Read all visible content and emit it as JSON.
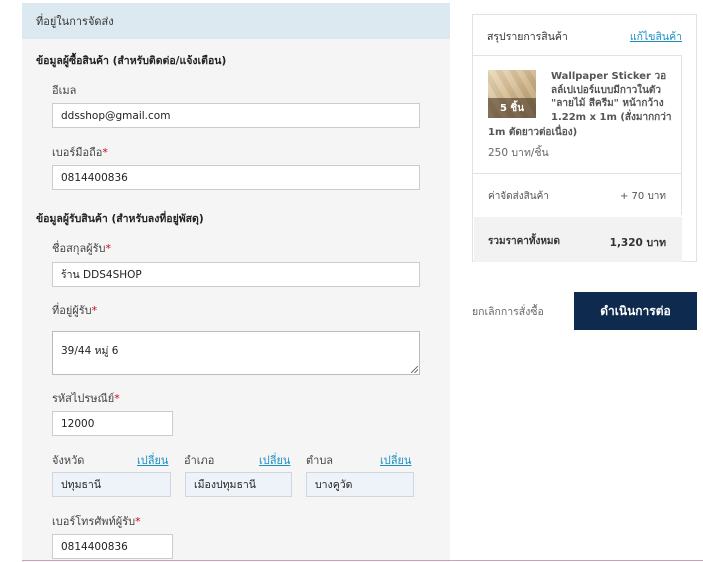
{
  "form": {
    "header": "ที่อยู่ในการจัดส่ง",
    "buyer_section": "ข้อมูลผู้ซื้อสินค้า (สำหรับติดต่อ/แจ้งเตือน)",
    "email_label": "อีเมล",
    "email_value": "ddsshop@gmail.com",
    "mobile_label": "เบอร์มือถือ",
    "mobile_value": "0814400836",
    "recipient_section": "ข้อมูลผู้รับสินค้า (สำหรับลงที่อยู่พัสดุ)",
    "name_label": "ชื่อสกุลผู้รับ",
    "name_value": "ร้าน DDS4SHOP",
    "address_label": "ที่อยู่ผู้รับ",
    "address_value": "39/44 หมู่ 6",
    "postcode_label": "รหัสไปรษณีย์",
    "postcode_value": "12000",
    "province_label": "จังหวัด",
    "province_value": "ปทุมธานี",
    "district_label": "อำเภอ",
    "district_value": "เมืองปทุมธานี",
    "subdistrict_label": "ตำบล",
    "subdistrict_value": "บางคูวัด",
    "change_label": "เปลี่ยน",
    "phone_label": "เบอร์โทรศัพท์ผู้รับ",
    "phone_value": "0814400836",
    "required_mark": "*"
  },
  "summary": {
    "title": "สรุปรายการสินค้า",
    "edit_label": "แก้ไขสินค้า",
    "product_qty": "5 ชิ้น",
    "product_name": "Wallpaper Sticker วอลล์เปเปอร์แบบมีกาวในตัว \"ลายไม้ สีครีม\" หน้ากว้าง 1.22m x 1m (สั่งมากกว่า",
    "product_name_cont": "1m ตัดยาวต่อเนื่อง)",
    "product_price": "250 บาท/ชิ้น",
    "shipping_label": "ค่าจัดส่งสินค้า",
    "shipping_value": "+ 70 บาท",
    "total_label": "รวมราคาทั้งหมด",
    "total_value": "1,320 บาท"
  },
  "actions": {
    "cancel_label": "ยกเลิกการสั่งซื้อ",
    "continue_label": "ดำเนินการต่อ"
  },
  "colors": {
    "header_bg": "#dde9f0",
    "link": "#1a8fc4",
    "button_bg": "#0e2a4f",
    "required": "#d0021b"
  }
}
